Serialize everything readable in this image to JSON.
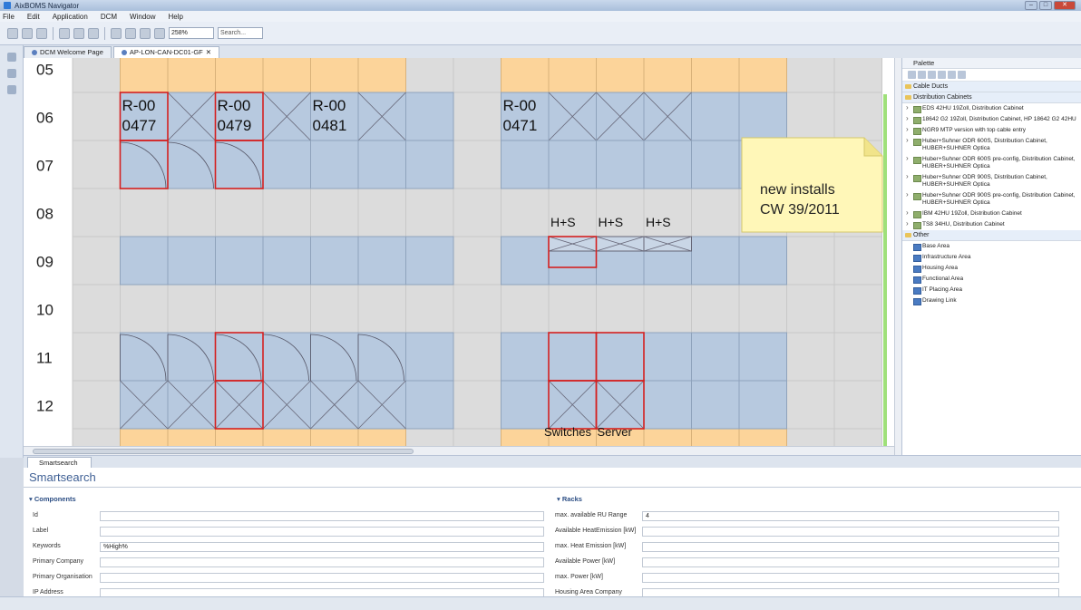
{
  "window": {
    "title": "AixBOMS Navigator"
  },
  "menu": [
    "File",
    "Edit",
    "Application",
    "DCM",
    "Window",
    "Help"
  ],
  "toolbar": {
    "zoom": "258%",
    "search_placeholder": "Search..."
  },
  "editor_tabs": [
    {
      "label": "DCM Welcome Page"
    },
    {
      "label": "AP-LON-CAN-DC01-GF"
    }
  ],
  "floorplan": {
    "row_labels": [
      "05",
      "06",
      "07",
      "08",
      "09",
      "10",
      "11",
      "12"
    ],
    "rack_labels": [
      {
        "text": "R-00\n0477"
      },
      {
        "text": "R-00\n0479"
      },
      {
        "text": "R-00\n0481"
      },
      {
        "text": "R-00\n0471"
      }
    ],
    "hs_labels": [
      "H+S",
      "H+S",
      "H+S"
    ],
    "switches_label": "Switches",
    "server_label": "Server",
    "note": {
      "line1": "new installs",
      "line2": "CW 39/2011"
    }
  },
  "palette": {
    "title": "Palette",
    "drawers": [
      {
        "label": "Cable Ducts",
        "items": []
      },
      {
        "label": "Distribution Cabinets",
        "items": [
          "EDS 42HU 19Zoll, Distribution Cabinet",
          "18642 G2 19Zoll, Distribution Cabinet, HP 18642 G2 42HU",
          "NGR9 MTP version with top cable entry",
          "Huber+Suhner ODR 600S, Distribution Cabinet, HUBER+SUHNER Optica",
          "Huber+Suhner ODR 600S pre-config, Distribution Cabinet, HUBER+SUHNER Optica",
          "Huber+Suhner ODR 900S, Distribution Cabinet, HUBER+SUHNER Optica",
          "Huber+Suhner ODR 900S pre-config, Distribution Cabinet, HUBER+SUHNER Optica",
          "IBM 42HU 19Zoll, Distribution Cabinet",
          "TS8 34HU, Distribution Cabinet"
        ]
      },
      {
        "label": "Other",
        "items": [
          "Base Area",
          "Infrastructure Area",
          "Housing Area",
          "Functional Area",
          "IT Placing Area",
          "Drawing Link"
        ]
      }
    ]
  },
  "bottom": {
    "tab": "Smartsearch",
    "title": "Smartsearch",
    "components": {
      "header": "Components",
      "fields": [
        {
          "label": "Id",
          "value": ""
        },
        {
          "label": "Label",
          "value": ""
        },
        {
          "label": "Keywords",
          "value": "%High%"
        },
        {
          "label": "Primary Company",
          "value": ""
        },
        {
          "label": "Primary Organisation",
          "value": ""
        },
        {
          "label": "IP Address",
          "value": ""
        }
      ]
    },
    "racks": {
      "header": "Racks",
      "fields": [
        {
          "label": "max. available RU Range",
          "value": "4"
        },
        {
          "label": "Available HeatEmission [kW]",
          "value": ""
        },
        {
          "label": "max. Heat Emission [kW]",
          "value": ""
        },
        {
          "label": "Available Power [kW]",
          "value": ""
        },
        {
          "label": "max. Power [kW]",
          "value": ""
        },
        {
          "label": "Housing Area Company",
          "value": ""
        }
      ]
    }
  }
}
